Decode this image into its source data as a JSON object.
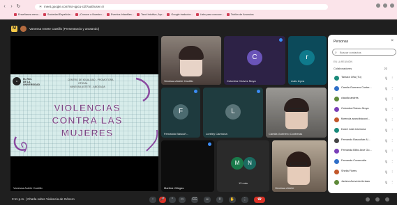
{
  "browser": {
    "url": "meet.google.com/rsn-qpcu-cdt?authuser=0",
    "bookmarks": [
      "Enseñanza remo...",
      "Sociedad Española...",
      "¡Conoce a Nuestro...",
      "Eventos Infantiles...",
      "Tarot Intuitivo, Apr...",
      "Google traductor...",
      "Lista para conocer...",
      "Tablón de Anuncios"
    ]
  },
  "meeting": {
    "title": "Vanessa Astete Castillo (Presentando y anotando)",
    "bottom_label": "3:11 p.m. | Charla sobre Violencia de Género"
  },
  "presentation": {
    "org": [
      "EL ROL",
      "DE LA",
      "UNIVERSIDAD"
    ],
    "lines": [
      "CENTRO DE IGUALDAD - PROMOTORA",
      "OFICIAL",
      "VANESSA ASTETE - ABOGADA"
    ],
    "title_lines": [
      "VIOLENCIAS",
      "CONTRA LAS",
      "MUJERES"
    ],
    "label": "Vanessa Astete Castillo"
  },
  "tiles": [
    {
      "name": "Vanessa Astete Castillo",
      "initial": ""
    },
    {
      "name": "Colomba Chávez Moya",
      "initial": "C"
    },
    {
      "name": "malu leyva",
      "initial": "r"
    },
    {
      "name": "Fernando Bascuñ...",
      "initial": "F"
    },
    {
      "name": "Loreley Carmona",
      "initial": "L"
    },
    {
      "name": "Camila Guerrero Contreras",
      "initial": ""
    },
    {
      "name": "Martina Villegas",
      "initial": ""
    },
    {
      "name": "13 más",
      "initial_a": "M",
      "initial_b": "N"
    },
    {
      "name": "Vanessa Astete",
      "initial": ""
    }
  ],
  "people": {
    "title": "Personas",
    "close": "×",
    "search_placeholder": "Buscar contactos",
    "section": "EN LA REUNIÓN",
    "collab_label": "Colaboradores",
    "collab_count": "22",
    "list": [
      {
        "name": "Tamara Oña (Tú)",
        "color": "#1a8a7a"
      },
      {
        "name": "Camila Guerrero Contre...",
        "color": "#2f6fc8"
      },
      {
        "name": "claudia andrés",
        "color": "#5f8a3a"
      },
      {
        "name": "Colomba Chávez Moya",
        "color": "#7a3fb8"
      },
      {
        "name": "florencia arancibiaconi...",
        "color": "#c2572a"
      },
      {
        "name": "Dulcé Julia Carmona",
        "color": "#1a8a7a"
      },
      {
        "name": "Fernando Bascuñán Al...",
        "color": "#444"
      },
      {
        "name": "Fernanda Bilbo Arce Go...",
        "color": "#7a3fb8"
      },
      {
        "name": "Fernanda Covarrubia",
        "color": "#2f6fc8"
      },
      {
        "name": "Sheila Flores",
        "color": "#c2572a"
      },
      {
        "name": "Javiera Acevedo Arriaza",
        "color": "#5f8a3a"
      }
    ]
  },
  "controls": [
    "↑",
    "mic",
    "cam",
    "cc",
    "emoji",
    "share",
    "hand",
    "more",
    "end"
  ],
  "colors": {
    "chrome": "#fbe4ea",
    "meet_bg": "#1f1f1f",
    "end_call": "#d93025",
    "accent_blue": "#3b8cf5"
  }
}
